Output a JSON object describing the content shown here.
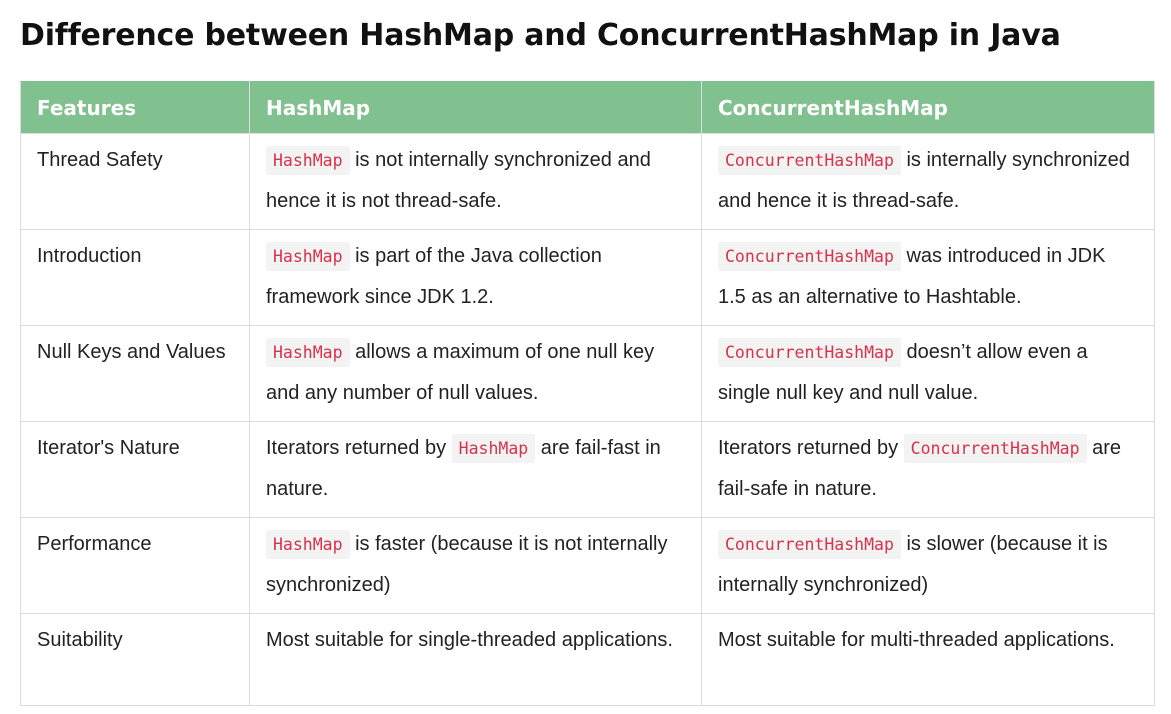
{
  "page": {
    "title": "Difference between HashMap and ConcurrentHashMap in Java"
  },
  "table": {
    "headers": [
      "Features",
      "HashMap",
      "ConcurrentHashMap"
    ],
    "rows": [
      {
        "feature": "Thread Safety",
        "hashmap": {
          "code": "HashMap",
          "text": " is not internally synchronized and hence it is not thread-safe."
        },
        "concurrent": {
          "code": "ConcurrentHashMap",
          "text": " is internally synchronized and hence it is thread-safe."
        }
      },
      {
        "feature": "Introduction",
        "hashmap": {
          "code": "HashMap",
          "text": " is part of the Java collection framework since JDK 1.2."
        },
        "concurrent": {
          "code": "ConcurrentHashMap",
          "text": " was introduced in JDK 1.5 as an alternative to Hashtable."
        }
      },
      {
        "feature": "Null Keys and Values",
        "hashmap": {
          "code": "HashMap",
          "text": " allows a maximum of one null key and any number of null values."
        },
        "concurrent": {
          "code": "ConcurrentHashMap",
          "text": " doesn’t allow even a single null key and null value."
        }
      },
      {
        "feature": "Iterator's Nature",
        "hashmap": {
          "before": "Iterators returned by ",
          "code": "HashMap",
          "after": " are fail-fast in nature."
        },
        "concurrent": {
          "before": "Iterators returned by ",
          "code": "ConcurrentHashMap",
          "after": " are fail-safe in nature."
        }
      },
      {
        "feature": "Performance",
        "hashmap": {
          "code": "HashMap",
          "text": " is faster (because it is not internally synchronized)"
        },
        "concurrent": {
          "code": "ConcurrentHashMap",
          "text": " is slower (because it is internally synchronized)"
        }
      },
      {
        "feature": "Suitability",
        "hashmap": {
          "text": "Most suitable for single-threaded applications."
        },
        "concurrent": {
          "text": "Most suitable for multi-threaded applications."
        }
      }
    ]
  }
}
